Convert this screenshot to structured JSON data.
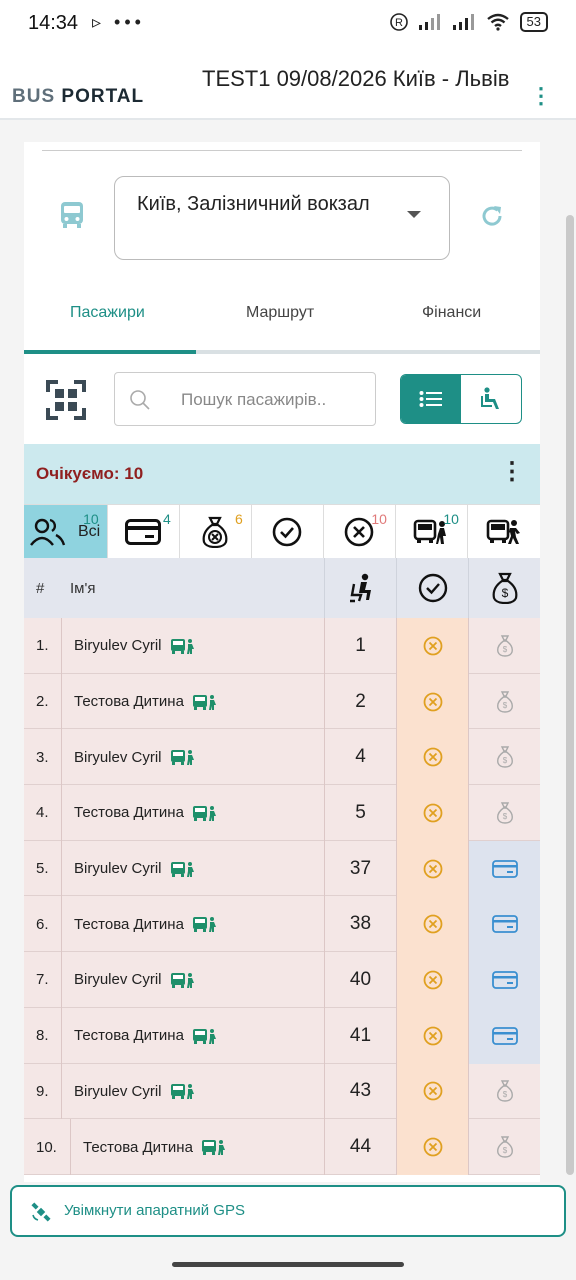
{
  "statusbar": {
    "time": "14:34",
    "left_icons": "▹ •••",
    "battery": "53"
  },
  "appbar": {
    "logo_bus": "BUS",
    "logo_portal": "PORTAL",
    "title": "TEST1 09/08/2026 Київ - Львів",
    "menu_icon": "more-vertical-icon"
  },
  "station_select": {
    "value": "Київ, Залізничний вокзал"
  },
  "tabs": [
    {
      "label": "Пасажири",
      "active": true
    },
    {
      "label": "Маршрут",
      "active": false
    },
    {
      "label": "Фінанси",
      "active": false
    }
  ],
  "search": {
    "placeholder": "Пошук пасажирів.."
  },
  "wait_bar": {
    "text": "Очікуємо: 10"
  },
  "filters": [
    {
      "icon": "people-icon",
      "label": "Всі",
      "count": "10",
      "count_color": "#1e8f86"
    },
    {
      "icon": "card-icon",
      "label": "",
      "count": "4",
      "count_color": "#1e8f86"
    },
    {
      "icon": "money-bag-cross-icon",
      "label": "",
      "count": "6",
      "count_color": "#e0a020"
    },
    {
      "icon": "check-circle-icon",
      "label": "",
      "count": "",
      "count_color": "#1e8f86"
    },
    {
      "icon": "cross-circle-icon",
      "label": "",
      "count": "10",
      "count_color": "#e07a7a"
    },
    {
      "icon": "bus-boarding-icon",
      "label": "",
      "count": "10",
      "count_color": "#1e8f86"
    },
    {
      "icon": "bus-leaving-icon",
      "label": "",
      "count": "",
      "count_color": "#1e8f86"
    }
  ],
  "table": {
    "headers": {
      "num": "#",
      "name": "Ім'я",
      "seat_icon": "seat-icon",
      "check_icon": "check-circle-icon",
      "pay_icon": "money-bag-icon"
    },
    "rows": [
      {
        "num": "1.",
        "name": "Biryulev Cyril",
        "seat": "1",
        "pay": "cash"
      },
      {
        "num": "2.",
        "name": "Тестова Дитина",
        "seat": "2",
        "pay": "cash"
      },
      {
        "num": "3.",
        "name": "Biryulev Cyril",
        "seat": "4",
        "pay": "cash"
      },
      {
        "num": "4.",
        "name": "Тестова Дитина",
        "seat": "5",
        "pay": "cash"
      },
      {
        "num": "5.",
        "name": "Biryulev Cyril",
        "seat": "37",
        "pay": "card"
      },
      {
        "num": "6.",
        "name": "Тестова Дитина",
        "seat": "38",
        "pay": "card"
      },
      {
        "num": "7.",
        "name": "Biryulev Cyril",
        "seat": "40",
        "pay": "card"
      },
      {
        "num": "8.",
        "name": "Тестова Дитина",
        "seat": "41",
        "pay": "card"
      },
      {
        "num": "9.",
        "name": "Biryulev Cyril",
        "seat": "43",
        "pay": "cash"
      },
      {
        "num": "10.",
        "name": "Тестова Дитина",
        "seat": "44",
        "pay": "cash"
      }
    ]
  },
  "gps_button": {
    "label": "Увімкнути апаратний GPS"
  },
  "colors": {
    "accent": "#1e8f86",
    "wait_text": "#8f1f1f",
    "status_orange": "#e0a020"
  }
}
